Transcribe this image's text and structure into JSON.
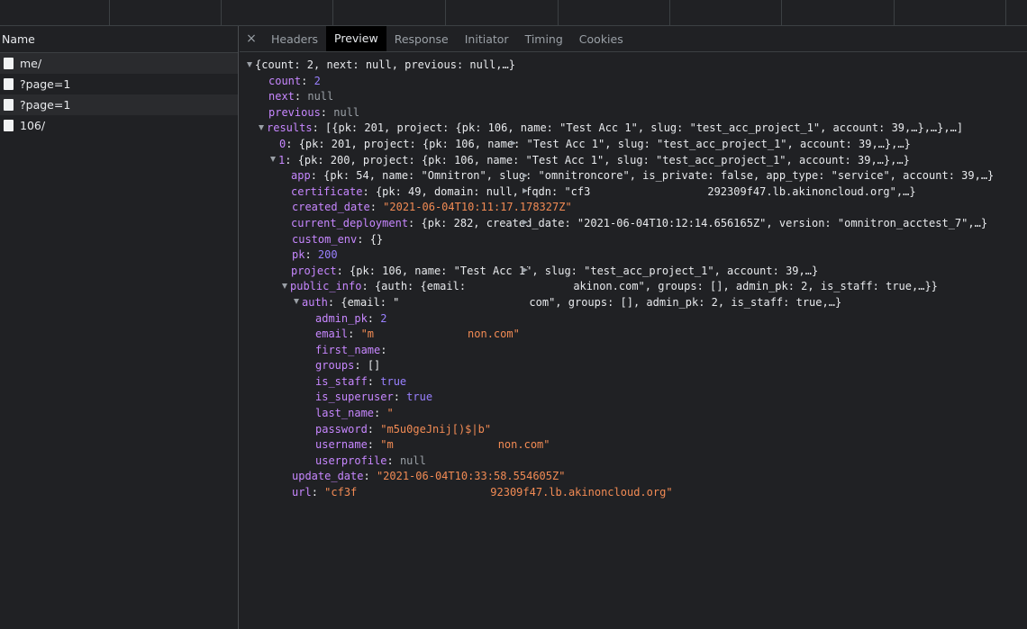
{
  "left_panel": {
    "header": "Name",
    "requests": [
      "me/",
      "?page=1",
      "?page=1",
      "106/"
    ]
  },
  "tabs": [
    "Headers",
    "Preview",
    "Response",
    "Initiator",
    "Timing",
    "Cookies"
  ],
  "active_tab": "Preview",
  "close_glyph": "×",
  "preview": {
    "root_summary": "{count: 2, next: null, previous: null,…}",
    "count_key": "count",
    "count_val": "2",
    "next_key": "next",
    "next_val": "null",
    "previous_key": "previous",
    "previous_val": "null",
    "results_key": "results",
    "results_summary": "[{pk: 201, project: {pk: 106, name: \"Test Acc 1\", slug: \"test_acc_project_1\", account: 39,…},…},…]",
    "item0_key": "0",
    "item0_summary": "{pk: 201, project: {pk: 106, name: \"Test Acc 1\", slug: \"test_acc_project_1\", account: 39,…},…}",
    "item1_key": "1",
    "item1_summary": "{pk: 200, project: {pk: 106, name: \"Test Acc 1\", slug: \"test_acc_project_1\", account: 39,…},…}",
    "app_key": "app",
    "app_summary": "{pk: 54, name: \"Omnitron\", slug: \"omnitroncore\", is_private: false, app_type: \"service\", account: 39,…}",
    "certificate_key": "certificate",
    "certificate_summary_a": "{pk: 49, domain: null, fqdn: \"cf3",
    "certificate_summary_b": "292309f47.lb.akinoncloud.org\",…}",
    "created_date_key": "created_date",
    "created_date_val": "\"2021-06-04T10:11:17.178327Z\"",
    "current_deployment_key": "current_deployment",
    "current_deployment_summary": "{pk: 282, created_date: \"2021-06-04T10:12:14.656165Z\", version: \"omnitron_acctest_7\",…}",
    "custom_env_key": "custom_env",
    "custom_env_val": "{}",
    "pk_key": "pk",
    "pk_val": "200",
    "project_key": "project",
    "project_summary": "{pk: 106, name: \"Test Acc 1\", slug: \"test_acc_project_1\", account: 39,…}",
    "public_info_key": "public_info",
    "public_info_summary_a": "{auth: {email: ",
    "public_info_summary_b": "akinon.com\", groups: [], admin_pk: 2, is_staff: true,…}}",
    "auth_key": "auth",
    "auth_summary_a": "{email: \"",
    "auth_summary_b": "com\", groups: [], admin_pk: 2, is_staff: true,…}",
    "admin_pk_key": "admin_pk",
    "admin_pk_val": "2",
    "email_key": "email",
    "email_val_a": "\"m",
    "email_val_b": "non.com\"",
    "first_name_key": "first_name",
    "groups_key": "groups",
    "groups_val": "[]",
    "is_staff_key": "is_staff",
    "is_staff_val": "true",
    "is_superuser_key": "is_superuser",
    "is_superuser_val": "true",
    "last_name_key": "last_name",
    "last_name_val": "\"",
    "password_key": "password",
    "password_val": "\"m5u0geJnij[)$|b\"",
    "username_key": "username",
    "username_val_a": "\"m",
    "username_val_b": "non.com\"",
    "userprofile_key": "userprofile",
    "userprofile_val": "null",
    "update_date_key": "update_date",
    "update_date_val": "\"2021-06-04T10:33:58.554605Z\"",
    "url_key": "url",
    "url_val_a": "\"cf3f",
    "url_val_b": "92309f47.lb.akinoncloud.org\""
  }
}
